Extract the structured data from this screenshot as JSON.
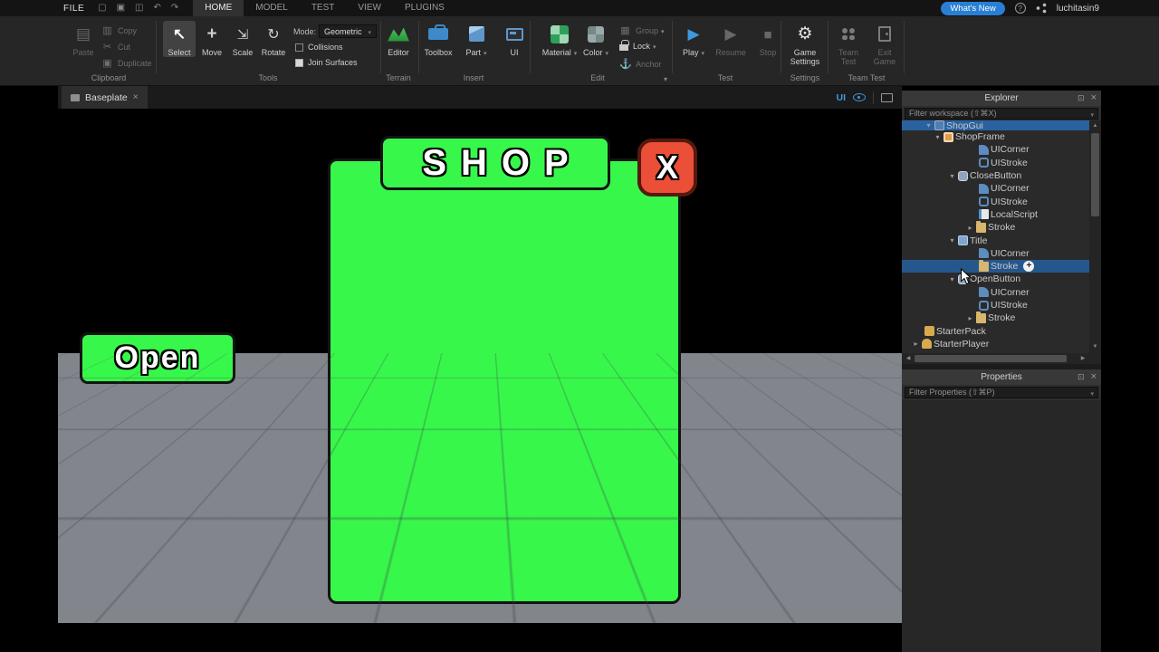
{
  "titlebar": {
    "file": "FILE",
    "tabs": [
      "HOME",
      "MODEL",
      "TEST",
      "VIEW",
      "PLUGINS"
    ],
    "whats_new": "What's New",
    "help": "?",
    "username": "luchitasin9"
  },
  "ribbon": {
    "clipboard": {
      "label": "Clipboard",
      "paste": "Paste",
      "copy": "Copy",
      "cut": "Cut",
      "duplicate": "Duplicate"
    },
    "tools": {
      "label": "Tools",
      "select": "Select",
      "move": "Move",
      "scale": "Scale",
      "rotate": "Rotate",
      "mode_label": "Mode:",
      "mode_value": "Geometric",
      "collisions": "Collisions",
      "join_surfaces": "Join Surfaces"
    },
    "terrain": {
      "label": "Terrain",
      "editor": "Editor"
    },
    "insert": {
      "label": "Insert",
      "toolbox": "Toolbox",
      "part": "Part",
      "ui": "UI"
    },
    "edit": {
      "label": "Edit",
      "material": "Material",
      "color": "Color",
      "group": "Group",
      "lock": "Lock",
      "anchor": "Anchor"
    },
    "test": {
      "label": "Test",
      "play": "Play",
      "resume": "Resume",
      "stop": "Stop"
    },
    "settings": {
      "label": "Settings",
      "game_settings": "Game Settings"
    },
    "team_test": {
      "label": "Team Test",
      "team_test": "Team Test",
      "exit_game": "Exit Game"
    }
  },
  "tabstrip": {
    "tab": "Baseplate",
    "close": "×",
    "ui": "UI"
  },
  "viewport": {
    "shop_title": "SHOP",
    "close_label": "X",
    "open_label": "Open"
  },
  "explorer": {
    "title": "Explorer",
    "filter": "Filter workspace (⇧⌘X)",
    "tree": [
      {
        "label": "ShopGui"
      },
      {
        "label": "ShopFrame"
      },
      {
        "label": "UICorner"
      },
      {
        "label": "UIStroke"
      },
      {
        "label": "CloseButton"
      },
      {
        "label": "UICorner"
      },
      {
        "label": "UIStroke"
      },
      {
        "label": "LocalScript"
      },
      {
        "label": "Stroke"
      },
      {
        "label": "Title"
      },
      {
        "label": "UICorner"
      },
      {
        "label": "Stroke"
      },
      {
        "label": "OpenButton"
      },
      {
        "label": "UICorner"
      },
      {
        "label": "UIStroke"
      },
      {
        "label": "Stroke"
      },
      {
        "label": "StarterPack"
      },
      {
        "label": "StarterPlayer"
      }
    ]
  },
  "properties": {
    "title": "Properties",
    "filter": "Filter Properties (⇧⌘P)"
  },
  "colors": {
    "accent_green": "#38f74b",
    "close_red": "#ec4f38",
    "selection_blue": "#2a62a0",
    "play_blue": "#3e9ae0"
  }
}
